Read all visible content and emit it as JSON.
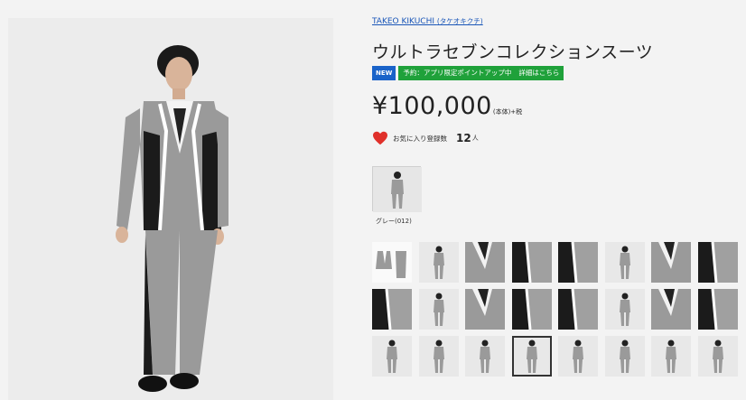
{
  "product": {
    "brand": "TAKEO KIKUCHI",
    "brand_kana": "(タケオキクチ)",
    "title": "ウルトラセブンコレクションスーツ",
    "badge_new": "NEW",
    "promo_text": "予約：アプリ限定ポイントアップ中",
    "promo_link": "詳細はこちら",
    "price": "¥100,000",
    "price_suffix": "(本体)+税",
    "favorite_label": "お気に入り登録数",
    "favorite_count": "12",
    "favorite_unit": "人",
    "color_name": "グレー(012)"
  },
  "colors": {
    "brand_link": "#1a56b8",
    "new_badge": "#1a63c9",
    "promo_badge": "#1fa13a",
    "heart": "#e0302a",
    "suit_gray": "#9a9a9a",
    "suit_black": "#1b1b1b"
  },
  "icons": {
    "favorite": "heart-icon"
  },
  "thumbnails": {
    "count": 24,
    "selected_index": 19
  }
}
